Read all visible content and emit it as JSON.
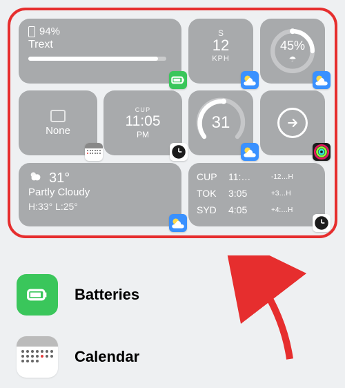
{
  "battery": {
    "percent": "94%",
    "device": "Trext"
  },
  "wind": {
    "compass": "S",
    "value": "12",
    "unit": "KPH"
  },
  "rain": {
    "percent": "45%",
    "icon_glyph": "☂"
  },
  "calendar_tile": {
    "text": "None"
  },
  "clock_tile": {
    "city": "CUP",
    "time": "11:05",
    "ampm": "PM"
  },
  "uv": {
    "value": "31"
  },
  "weather": {
    "temp": "31°",
    "condition": "Partly Cloudy",
    "high_low": "H:33° L:25°"
  },
  "world": {
    "rows": [
      {
        "city": "CUP",
        "time": "11:…",
        "offset": "-12…H"
      },
      {
        "city": "TOK",
        "time": "3:05",
        "offset": "+3…H"
      },
      {
        "city": "SYD",
        "time": "4:05",
        "offset": "+4:…H"
      }
    ]
  },
  "list": {
    "batteries": "Batteries",
    "calendar": "Calendar"
  }
}
